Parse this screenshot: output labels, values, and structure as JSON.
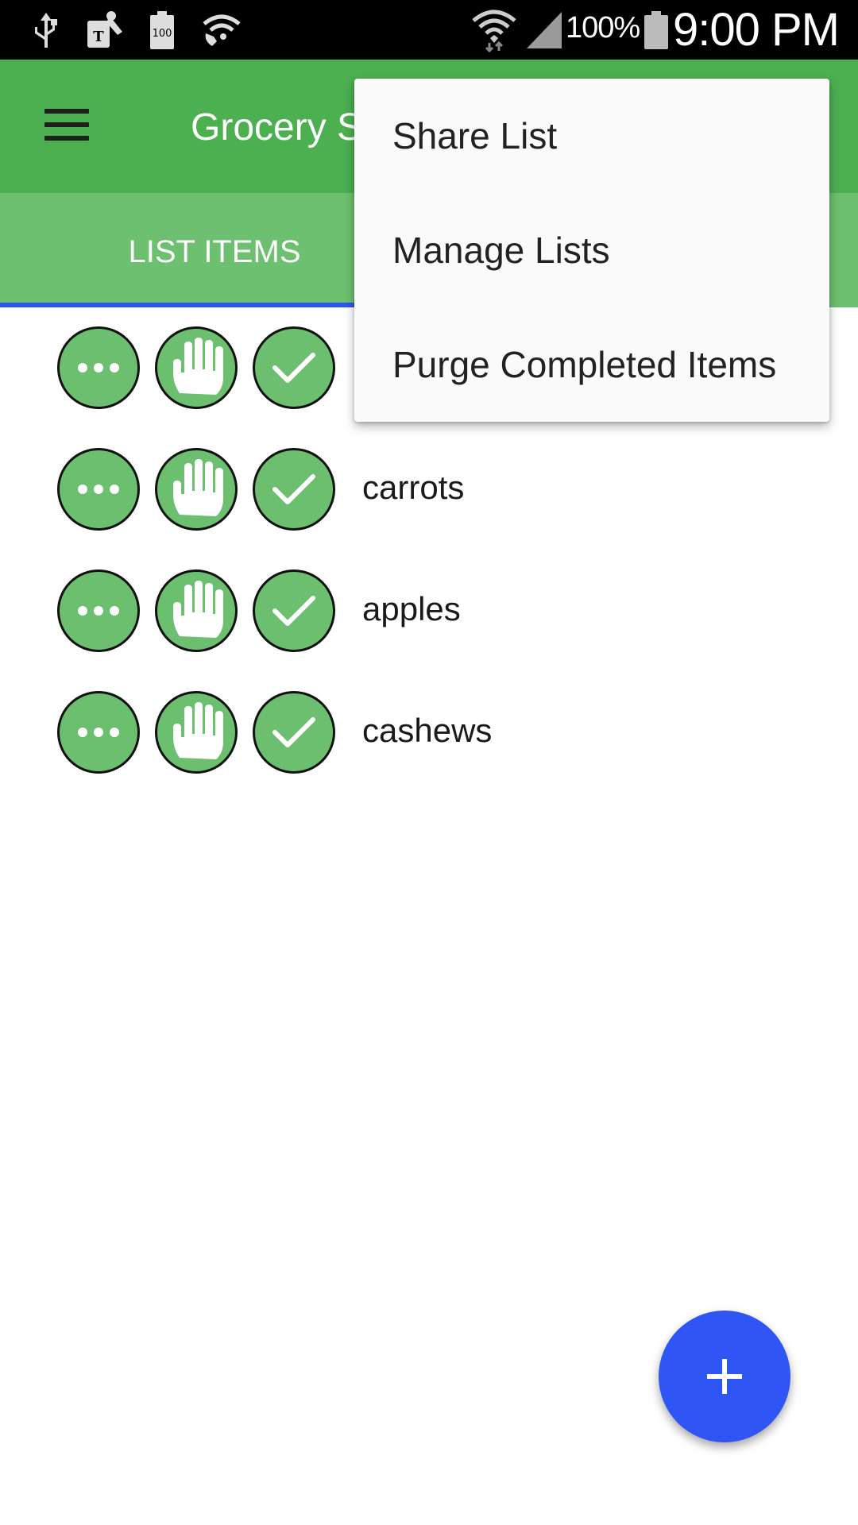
{
  "status_bar": {
    "battery_percent": "100%",
    "time": "9:00 PM",
    "icons": [
      "usb-icon",
      "tmobile-icon",
      "battery-100-icon",
      "wifi-calling-icon",
      "wifi-icon",
      "signal-icon",
      "battery-icon"
    ]
  },
  "app_bar": {
    "title": "Grocery S",
    "menu_icon": "hamburger-icon"
  },
  "tabs": [
    {
      "label": "LIST ITEMS",
      "selected": true
    }
  ],
  "list": {
    "items": [
      {
        "label": ""
      },
      {
        "label": "carrots"
      },
      {
        "label": "apples"
      },
      {
        "label": "cashews"
      }
    ],
    "row_icons": [
      "more-icon",
      "hand-icon",
      "check-icon"
    ]
  },
  "overflow_menu": {
    "items": [
      {
        "label": "Share List"
      },
      {
        "label": "Manage Lists"
      },
      {
        "label": "Purge Completed Items"
      }
    ]
  },
  "fab": {
    "icon": "plus-icon"
  },
  "colors": {
    "app_bar": "#4caf50",
    "tab_bar": "#6dc06f",
    "accent": "#2f55f5",
    "circle_fill": "#6bbf6f"
  }
}
